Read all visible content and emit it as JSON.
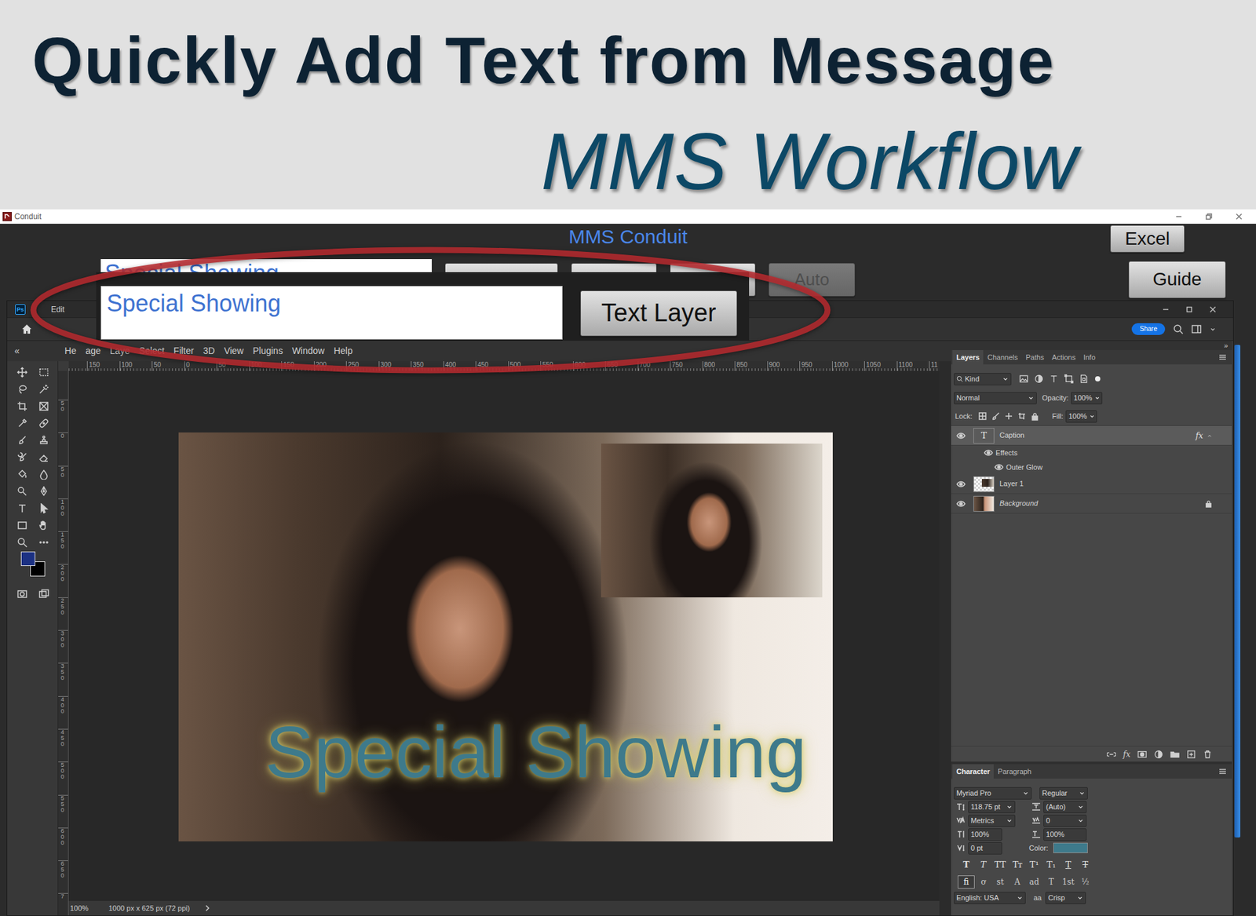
{
  "banner": {
    "title": "Quickly Add Text from Message",
    "subtitle": "MMS Workflow"
  },
  "conduit": {
    "window_title": "Conduit",
    "heading": "MMS Conduit",
    "excel_button": "Excel",
    "guide_button": "Guide",
    "back_field": {
      "value": "Special Showing"
    },
    "back_buttons": [
      {
        "disabled": false
      },
      {
        "disabled": false
      },
      {
        "disabled": false
      }
    ],
    "auto_button": {
      "label": "Auto",
      "disabled": true
    },
    "highlight": {
      "field_value": "Special Showing",
      "button": "Text Layer"
    }
  },
  "photoshop": {
    "app_badge": "Ps",
    "title_menu": "Edit",
    "share_button": "Share",
    "left_collapse": "«",
    "panel_collapse": "»",
    "menu": [
      "He",
      "age",
      "Laye",
      "Select",
      "Filter",
      "3D",
      "View",
      "Plugins",
      "Window",
      "Help"
    ],
    "ruler_top": [
      "150",
      "100",
      "50",
      "0",
      "50",
      "100",
      "150",
      "200",
      "250",
      "300",
      "350",
      "400",
      "450",
      "500",
      "550",
      "600",
      "650",
      "700",
      "750",
      "800",
      "850",
      "900",
      "950",
      "1000",
      "1050",
      "1100",
      "11"
    ],
    "ruler_left": [
      "50",
      "0",
      "50",
      "100",
      "150",
      "200",
      "250",
      "300",
      "350",
      "400",
      "450",
      "500",
      "550",
      "600",
      "650",
      "7"
    ],
    "canvas": {
      "caption": "Special Showing"
    },
    "status": {
      "zoom": "100%",
      "doc_info": "1000 px x 625 px (72 ppi)"
    },
    "layer_tabs": [
      {
        "label": "Layers",
        "selected": true
      },
      {
        "label": "Channels",
        "selected": false
      },
      {
        "label": "Paths",
        "selected": false
      },
      {
        "label": "Actions",
        "selected": false
      },
      {
        "label": "Info",
        "selected": false
      }
    ],
    "filter_kind": "Kind",
    "blend_mode": "Normal",
    "opacity_label": "Opacity:",
    "opacity": "100%",
    "lock_label": "Lock:",
    "fill_label": "Fill:",
    "fill": "100%",
    "layers": [
      {
        "name": "Caption",
        "kind": "text",
        "thumb": "T",
        "selected": true,
        "visible": true,
        "fx": "fx"
      },
      {
        "name": "Effects",
        "kind": "effects",
        "selected": false,
        "visible": true
      },
      {
        "name": "Outer Glow",
        "kind": "effect",
        "selected": false,
        "visible": true
      },
      {
        "name": "Layer 1",
        "kind": "image",
        "selected": false,
        "visible": true
      },
      {
        "name": "Background",
        "kind": "background",
        "selected": false,
        "visible": true,
        "locked": true
      }
    ],
    "layers_footer_fx": "fx",
    "character_tabs": [
      {
        "label": "Character",
        "selected": true
      },
      {
        "label": "Paragraph",
        "selected": false
      }
    ],
    "character": {
      "font": "Myriad Pro",
      "style": "Regular",
      "size": "118.75 pt",
      "leading": "(Auto)",
      "kerning": "Metrics",
      "tracking": "0",
      "vertical_scale": "100%",
      "horizontal_scale": "100%",
      "baseline_shift": "0 pt",
      "color_label": "Color:",
      "color": "#3e7a8b",
      "style_buttons": [
        {
          "label": "T",
          "kind": "bold"
        },
        {
          "label": "T",
          "kind": "italic"
        },
        {
          "label": "TT",
          "kind": "allcaps"
        },
        {
          "label": "Tт",
          "kind": "smallcaps"
        },
        {
          "label": "T¹",
          "kind": "superscript"
        },
        {
          "label": "T₁",
          "kind": "subscript"
        },
        {
          "label": "T",
          "kind": "underline"
        },
        {
          "label": "T",
          "kind": "strike"
        }
      ],
      "opentype_buttons": [
        {
          "label": "fi",
          "selected": true
        },
        {
          "label": "ơ",
          "selected": false
        },
        {
          "label": "st",
          "selected": false
        },
        {
          "label": "A",
          "selected": false
        },
        {
          "label": "ad",
          "selected": false
        },
        {
          "label": "T",
          "selected": false
        },
        {
          "label": "1st",
          "selected": false
        },
        {
          "label": "½",
          "selected": false
        }
      ],
      "language": "English: USA",
      "aa_icon": "aa",
      "antialias": "Crisp"
    }
  }
}
